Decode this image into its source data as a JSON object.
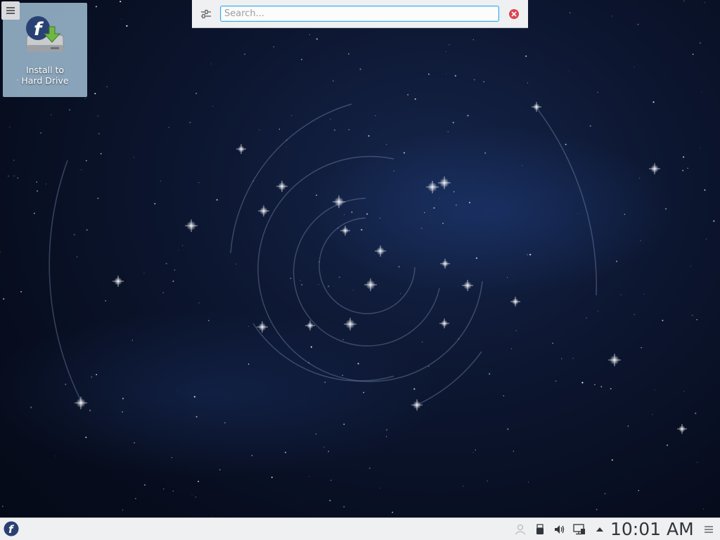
{
  "desktop": {
    "icons": [
      {
        "label_line1": "Install to",
        "label_line2": "Hard Drive",
        "icon": "fedora-install-drive-icon"
      }
    ],
    "toolbox_icon": "hamburger-menu-icon"
  },
  "krunner": {
    "search_placeholder": "Search...",
    "search_value": "",
    "config_icon": "configure-sliders-icon",
    "close_icon": "close-circle-icon"
  },
  "panel": {
    "launcher_icon": "fedora-logo-icon",
    "tray_icons": [
      "user-switcher-icon",
      "usb-device-icon",
      "volume-icon",
      "network-icon",
      "expand-arrow-icon"
    ],
    "clock": "10:01 AM",
    "options_icon": "panel-options-icon"
  },
  "colors": {
    "accent": "#3daee9",
    "panel_bg": "#eff0f1",
    "close_red": "#da4453",
    "fedora_blue": "#294172"
  }
}
